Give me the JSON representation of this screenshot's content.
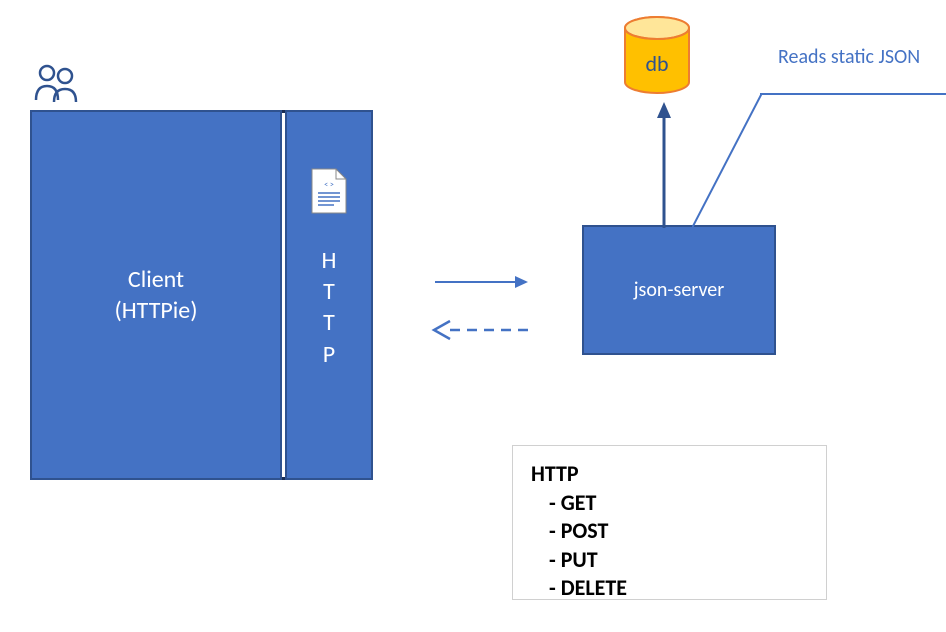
{
  "client": {
    "title": "Client\n(HTTPie)"
  },
  "http_column": {
    "letters": "H\nT\nT\nP"
  },
  "server": {
    "label": "json-server"
  },
  "db": {
    "label": "db"
  },
  "reads": {
    "label": "Reads static JSON"
  },
  "http_info": {
    "title": "HTTP",
    "methods": [
      "GET",
      "POST",
      "PUT",
      "DELETE"
    ]
  },
  "colors": {
    "box_fill": "#4472c4",
    "box_border": "#2f528f",
    "accent": "#4472c4",
    "db_fill": "#ffc000",
    "db_stroke": "#ed7d31"
  }
}
